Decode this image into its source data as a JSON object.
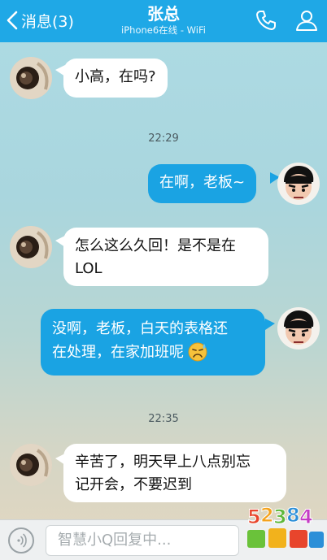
{
  "header": {
    "back_label": "消息(3)",
    "title": "张总",
    "subtitle": "iPhone6在线 - WiFi"
  },
  "messages": [
    {
      "side": "in",
      "text": "小高，在吗?"
    },
    {
      "time": "22:29"
    },
    {
      "side": "out",
      "text": "在啊，老板~"
    },
    {
      "side": "in",
      "text_line1": "怎么这么久回！是不是在",
      "text_line2": "LOL"
    },
    {
      "side": "out",
      "text_line1": "没啊，老板，白天的表格还",
      "text_line2": "在处理，在家加班呢",
      "emoji": "sad-sweat-emoji"
    },
    {
      "time": "22:35"
    },
    {
      "side": "in",
      "text_line1": "辛苦了，明天早上八点别忘",
      "text_line2": "记开会，不要迟到"
    }
  ],
  "input": {
    "placeholder": "智慧小Q回复中..."
  },
  "watermark": {
    "text": "52384"
  },
  "colors": {
    "header": "#1fa8e6",
    "outgoing_bubble": "#1aa3e3",
    "incoming_bubble": "#ffffff"
  }
}
